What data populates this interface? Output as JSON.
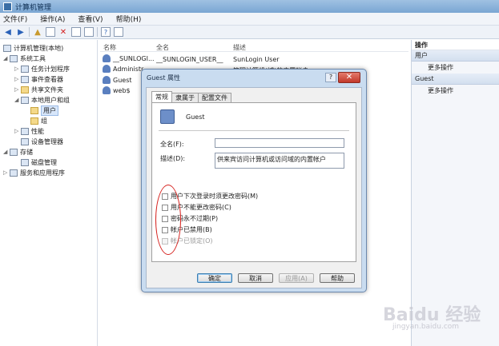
{
  "window": {
    "title": "计算机管理"
  },
  "menu": [
    "文件(F)",
    "操作(A)",
    "查看(V)",
    "帮助(H)"
  ],
  "tree": {
    "items": [
      {
        "label": "计算机管理(本地)",
        "expand": ""
      },
      {
        "label": "系统工具",
        "expand": "◢"
      },
      {
        "label": "任务计划程序",
        "expand": "▷"
      },
      {
        "label": "事件查看器",
        "expand": "▷"
      },
      {
        "label": "共享文件夹",
        "expand": "▷"
      },
      {
        "label": "本地用户和组",
        "expand": "◢"
      },
      {
        "label": "用户",
        "expand": ""
      },
      {
        "label": "组",
        "expand": ""
      },
      {
        "label": "性能",
        "expand": "▷"
      },
      {
        "label": "设备管理器",
        "expand": ""
      },
      {
        "label": "存储",
        "expand": "◢"
      },
      {
        "label": "磁盘管理",
        "expand": ""
      },
      {
        "label": "服务和应用程序",
        "expand": "▷"
      }
    ]
  },
  "list": {
    "headers": {
      "name": "名称",
      "fullname": "全名",
      "desc": "描述"
    },
    "rows": [
      {
        "name": "__SUNLOGI...",
        "fullname": "__SUNLOGIN_USER__",
        "desc": "SunLogin User"
      },
      {
        "name": "Administr...",
        "fullname": "",
        "desc": "管理计算机(域)的内置帐户"
      },
      {
        "name": "Guest",
        "fullname": "",
        "desc": ""
      },
      {
        "name": "web$",
        "fullname": "",
        "desc": ""
      }
    ]
  },
  "actions": {
    "header": "操作",
    "section1": "用户",
    "item1": "更多操作",
    "section2": "Guest",
    "item2": "更多操作"
  },
  "dialog": {
    "title": "Guest 属性",
    "help": "?",
    "close": "✕",
    "tabs": [
      "常规",
      "隶属于",
      "配置文件"
    ],
    "username": "Guest",
    "fullname_label": "全名(F):",
    "fullname_value": "",
    "desc_label": "描述(D):",
    "desc_value": "供来宾访问计算机或访问域的内置帐户",
    "checkboxes": [
      {
        "label": "用户下次登录时须更改密码(M)",
        "disabled": false
      },
      {
        "label": "用户不能更改密码(C)",
        "disabled": false
      },
      {
        "label": "密码永不过期(P)",
        "disabled": false
      },
      {
        "label": "帐户已禁用(B)",
        "disabled": false
      },
      {
        "label": "帐户已锁定(O)",
        "disabled": true
      }
    ],
    "buttons": {
      "ok": "确定",
      "cancel": "取消",
      "apply": "应用(A)",
      "help": "帮助"
    }
  },
  "watermark": {
    "main": "Baidu 经验",
    "sub": "jingyan.baidu.com"
  }
}
